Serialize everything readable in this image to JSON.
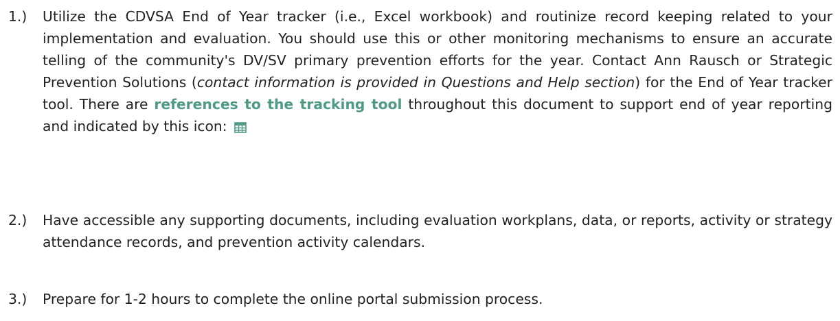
{
  "colors": {
    "text": "#222222",
    "highlight": "#4f9a86"
  },
  "items": [
    {
      "number": "1.)",
      "text_a": "Utilize the CDVSA End of Year tracker (i.e., Excel workbook) and routinize record keeping related to your implementation and evaluation. You should use this or other monitoring mechanisms to ensure an accurate telling of the community's DV/SV primary prevention efforts for the year. Contact Ann Rausch or Strategic Prevention Solutions (",
      "italic": "contact information is provided in Questions and Help section",
      "text_b": ") for the End of Year tracker tool. There are ",
      "highlight": "references to the tracking tool",
      "text_c": " throughout this document to support end of year reporting and indicated by this icon:",
      "icon": "table-grid-icon"
    },
    {
      "number": "2.)",
      "text": "Have accessible any supporting documents, including evaluation workplans, data, or reports, activity or strategy attendance records, and prevention activity calendars."
    },
    {
      "number": "3.)",
      "text": "Prepare for 1-2 hours to complete the online portal submission process."
    }
  ]
}
